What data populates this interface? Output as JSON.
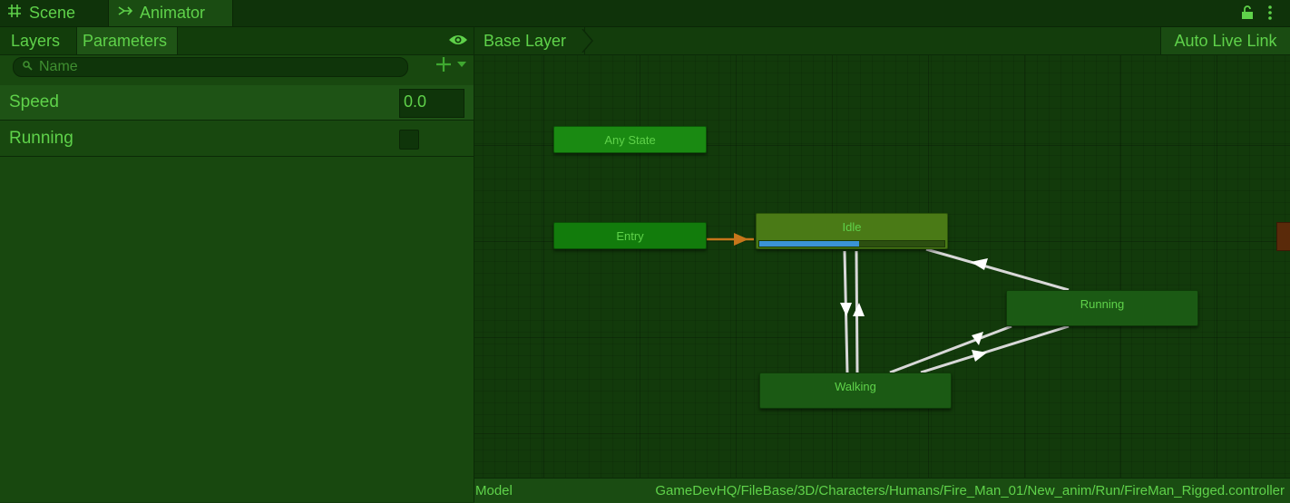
{
  "tabs": [
    {
      "label": "Scene",
      "icon": "grid-icon"
    },
    {
      "label": "Animator",
      "icon": "animator-icon"
    }
  ],
  "left_panel": {
    "subtabs": {
      "layers": "Layers",
      "parameters": "Parameters"
    },
    "search_placeholder": "Name",
    "parameters": [
      {
        "name": "Speed",
        "type": "float",
        "value": "0.0"
      },
      {
        "name": "Running",
        "type": "bool",
        "value": false
      }
    ]
  },
  "graph": {
    "breadcrumb": "Base Layer",
    "live_link": "Auto Live Link",
    "states": {
      "any": "Any State",
      "entry": "Entry",
      "idle": "Idle",
      "running": "Running",
      "walking": "Walking"
    },
    "idle_progress": 0.54
  },
  "status": {
    "label": "Model",
    "path": "GameDevHQ/FileBase/3D/Characters/Humans/Fire_Man_01/New_anim/Run/FireMan_Rigged.controller"
  },
  "colors": {
    "accent_text": "#5fd24a",
    "progress": "#3a93d6",
    "entry_transition": "#c6761b",
    "transition": "#d8d8d8"
  }
}
